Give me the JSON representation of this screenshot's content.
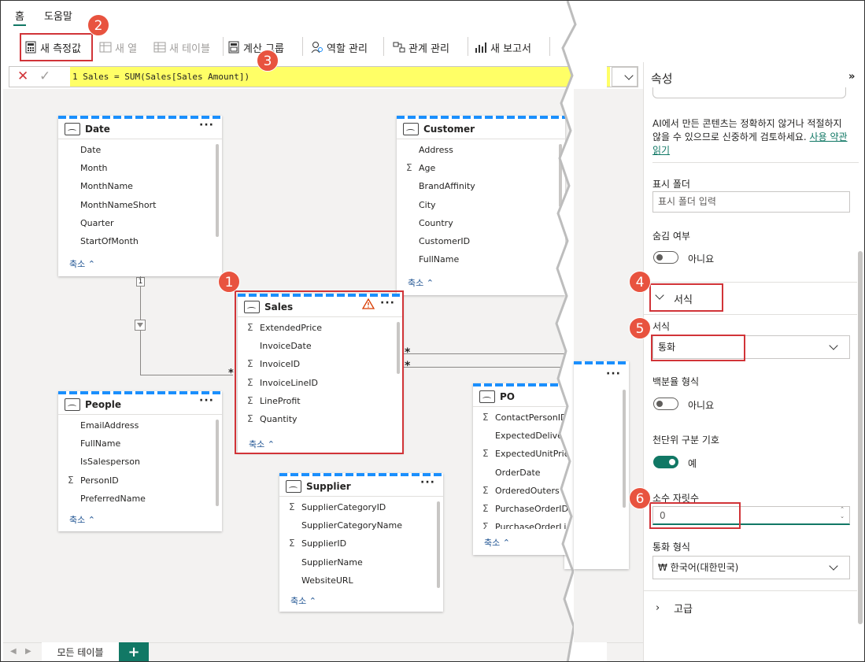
{
  "tabs": [
    "홈",
    "도움말"
  ],
  "ribbon": {
    "new_measure": "새 측정값",
    "new_column": "새 열",
    "new_table": "새 테이블",
    "calc_group": "계산 그룹",
    "manage_roles": "역할 관리",
    "manage_relationships": "관계 관리",
    "new_report": "새 보고서"
  },
  "formula": {
    "text": "1  Sales = SUM(Sales[Sales Amount])"
  },
  "tables": {
    "date": {
      "title": "Date",
      "fields": [
        "Date",
        "Month",
        "MonthName",
        "MonthNameShort",
        "Quarter",
        "StartOfMonth"
      ],
      "collapse": "축소"
    },
    "customer": {
      "title": "Customer",
      "fields": [
        "Address",
        "Age",
        "BrandAffinity",
        "City",
        "Country",
        "CustomerID",
        "FullName"
      ],
      "collapse": "축소"
    },
    "sales": {
      "title": "Sales",
      "fields": [
        "ExtendedPrice",
        "InvoiceDate",
        "InvoiceID",
        "InvoiceLineID",
        "LineProfit",
        "Quantity"
      ],
      "collapse": "축소"
    },
    "people": {
      "title": "People",
      "fields": [
        "EmailAddress",
        "FullName",
        "IsSalesperson",
        "PersonID",
        "PreferredName"
      ],
      "collapse": "축소"
    },
    "supplier": {
      "title": "Supplier",
      "fields": [
        "SupplierCategoryID",
        "SupplierCategoryName",
        "SupplierID",
        "SupplierName",
        "WebsiteURL"
      ],
      "collapse": "축소"
    },
    "po": {
      "title": "PO",
      "fields": [
        "ContactPersonID",
        "ExpectedDeliveryD",
        "ExpectedUnitPriceP",
        "OrderDate",
        "OrderedOuters",
        "PurchaseOrderID",
        "PurchaseOrderLi"
      ],
      "collapse": "축소"
    }
  },
  "rel": {
    "one": "1",
    "many": "*"
  },
  "bottom": {
    "all_tables": "모든 테이블",
    "add": "+"
  },
  "props": {
    "title": "속성",
    "ai_note": "AI에서 만든 콘텐츠는 정확하지 않거나 적절하지 않을 수 있으므로 신중하게 검토하세요.",
    "ai_link": "사용 약관 읽기",
    "display_folder_label": "표시 폴더",
    "display_folder_placeholder": "표시 폴더 입력",
    "hidden_label": "숨김 여부",
    "hidden_value": "아니요",
    "format_section": "서식",
    "format_label": "서식",
    "format_value": "통화",
    "percent_label": "백분율 형식",
    "percent_value": "아니요",
    "thousands_label": "천단위 구분 기호",
    "thousands_value": "예",
    "decimals_label": "소수 자릿수",
    "decimals_value": "0",
    "currency_label": "통화 형식",
    "currency_value": "₩ 한국어(대한민국)",
    "advanced_section": "고급"
  },
  "badges": [
    "1",
    "2",
    "3",
    "4",
    "5",
    "6"
  ],
  "colors": {
    "accent": "#117865",
    "callout": "#e8533f",
    "highlight": "#ffff66",
    "stripe": "#1a8ffd"
  }
}
